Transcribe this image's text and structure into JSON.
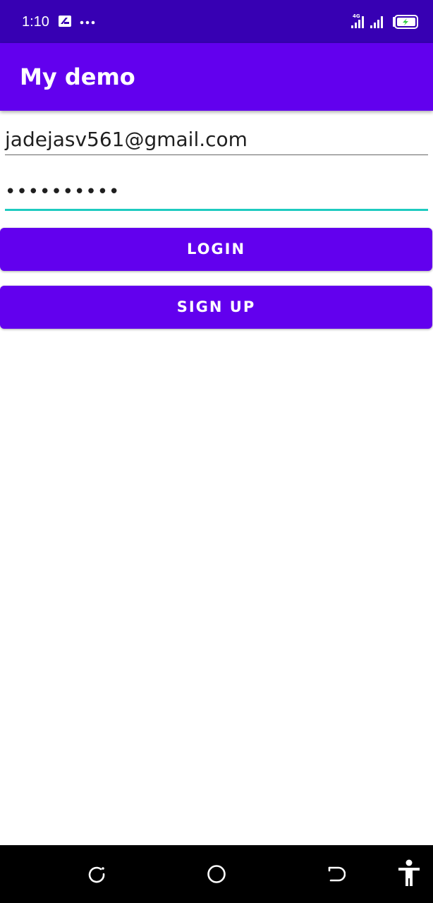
{
  "status_bar": {
    "time": "1:10",
    "icons": [
      "notification-icon",
      "more-dots-icon",
      "signal-4g-icon",
      "battery-charging-icon"
    ],
    "network_label": "4G",
    "background": "#3700b3"
  },
  "app_bar": {
    "title": "My demo",
    "background": "#6200ee"
  },
  "form": {
    "email": {
      "value": "jadejasv561@gmail.com"
    },
    "password": {
      "masked_value": "••••••••••",
      "underline_color": "#1ecbc0"
    }
  },
  "buttons": {
    "login_label": "LOGIN",
    "signup_label": "SIGN UP",
    "background": "#6200ee"
  },
  "nav_bar": {
    "icons": [
      "recents-icon",
      "home-icon",
      "back-icon",
      "accessibility-icon"
    ]
  }
}
